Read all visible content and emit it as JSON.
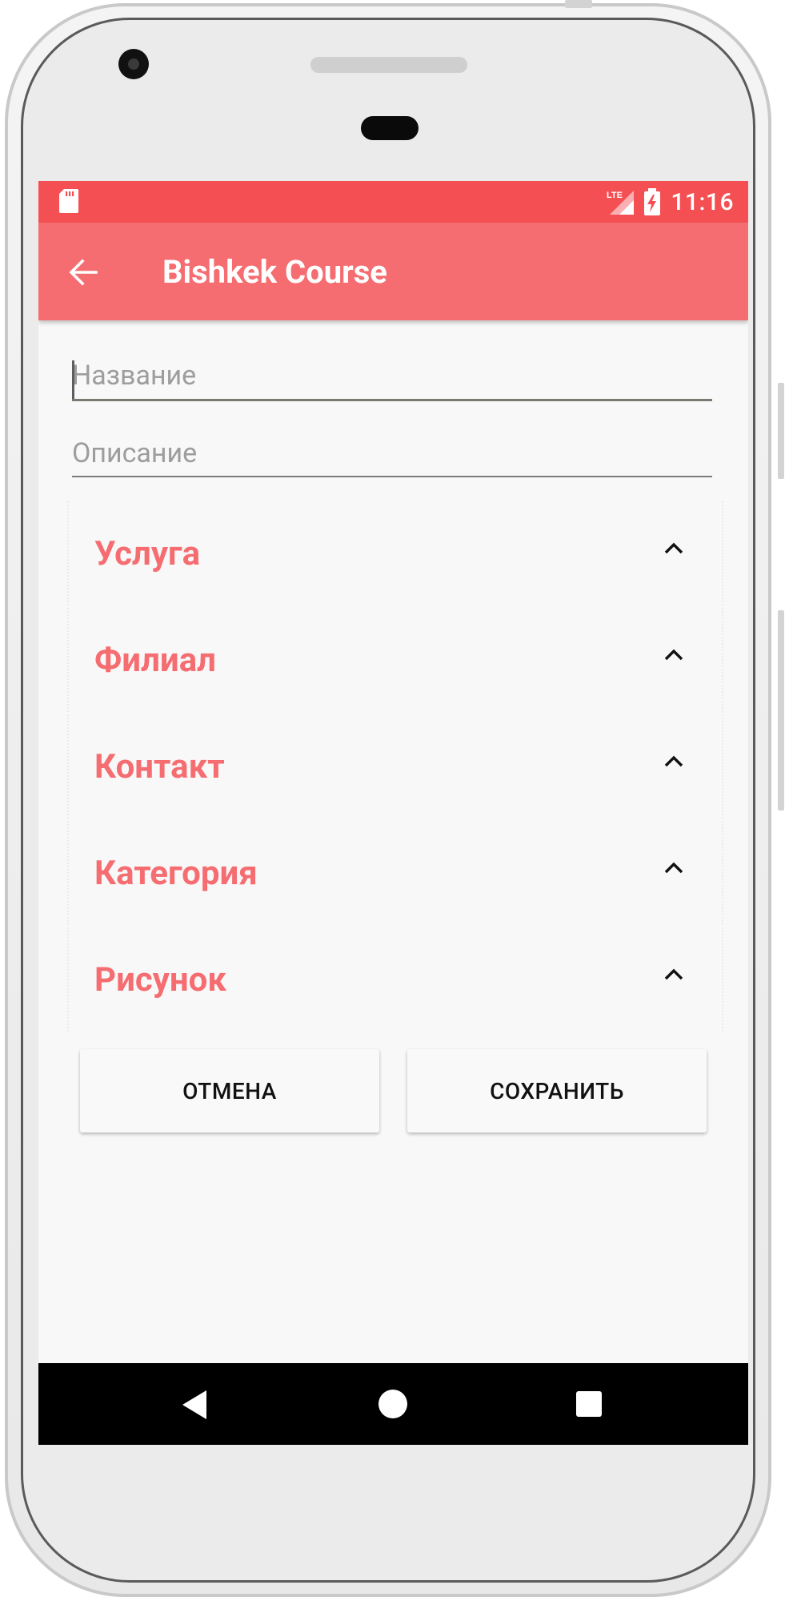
{
  "statusbar": {
    "time": "11:16",
    "network": "LTE",
    "icons": [
      "sd-card-icon",
      "signal-icon",
      "battery-charging-icon"
    ]
  },
  "appbar": {
    "title": "Bishkek Course",
    "back_icon": "arrow-back-icon"
  },
  "form": {
    "name": {
      "placeholder": "Название",
      "value": ""
    },
    "description": {
      "placeholder": "Описание",
      "value": ""
    }
  },
  "sections": [
    {
      "label": "Услуга"
    },
    {
      "label": "Филиал"
    },
    {
      "label": "Контакт"
    },
    {
      "label": "Категория"
    },
    {
      "label": "Рисунок"
    }
  ],
  "actions": {
    "cancel": "ОТМЕНА",
    "save": "СОХРАНИТЬ"
  },
  "colors": {
    "statusbar": "#f45054",
    "appbar": "#f56d71",
    "accent": "#f56d71"
  },
  "nav": {
    "back_icon": "nav-back-icon",
    "home_icon": "nav-home-icon",
    "recents_icon": "nav-recents-icon"
  }
}
